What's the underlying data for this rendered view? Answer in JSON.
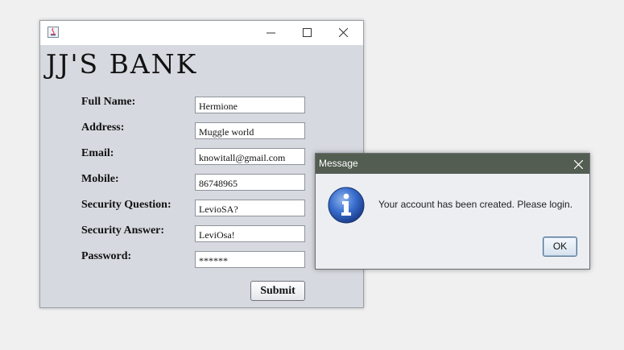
{
  "window": {
    "logo_text": "JJ'S BANK",
    "form": {
      "fields": [
        {
          "label": "Full Name:",
          "value": "Hermione"
        },
        {
          "label": "Address:",
          "value": "Muggle world"
        },
        {
          "label": "Email:",
          "value": "knowitall@gmail.com"
        },
        {
          "label": "Mobile:",
          "value": "86748965"
        },
        {
          "label": "Security Question:",
          "value": "LevioSA?"
        },
        {
          "label": "Security Answer:",
          "value": "LeviOsa!"
        },
        {
          "label": "Password:",
          "value": "******"
        }
      ],
      "submit_label": "Submit"
    },
    "controls": {
      "minimize_icon": "minimize-icon",
      "maximize_icon": "maximize-icon",
      "close_icon": "close-icon"
    }
  },
  "dialog": {
    "title": "Message",
    "message": "Your account has been created. Please login.",
    "ok_label": "OK",
    "icon": "info-icon",
    "title_color": "#535d51"
  }
}
